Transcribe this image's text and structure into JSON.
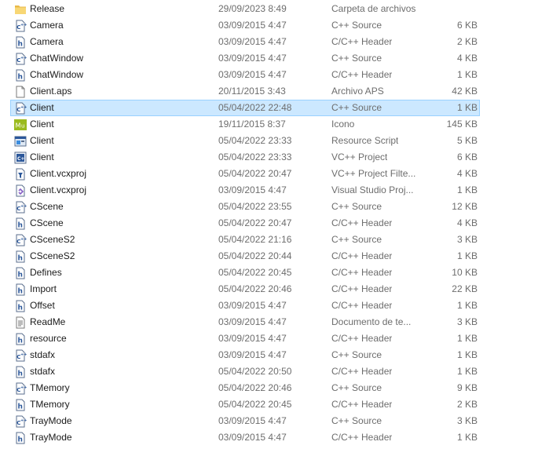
{
  "files": [
    {
      "name": "Release",
      "date": "29/09/2023 8:49",
      "type": "Carpeta de archivos",
      "size": "",
      "icon": "folder-icon"
    },
    {
      "name": "Camera",
      "date": "03/09/2015 4:47",
      "type": "C++ Source",
      "size": "6 KB",
      "icon": "cpp-source-icon"
    },
    {
      "name": "Camera",
      "date": "03/09/2015 4:47",
      "type": "C/C++ Header",
      "size": "2 KB",
      "icon": "c-header-icon"
    },
    {
      "name": "ChatWindow",
      "date": "03/09/2015 4:47",
      "type": "C++ Source",
      "size": "4 KB",
      "icon": "cpp-source-icon"
    },
    {
      "name": "ChatWindow",
      "date": "03/09/2015 4:47",
      "type": "C/C++ Header",
      "size": "1 KB",
      "icon": "c-header-icon"
    },
    {
      "name": "Client.aps",
      "date": "20/11/2015 3:43",
      "type": "Archivo APS",
      "size": "42 KB",
      "icon": "generic-file-icon"
    },
    {
      "name": "Client",
      "date": "05/04/2022 22:48",
      "type": "C++ Source",
      "size": "1 KB",
      "icon": "cpp-source-icon",
      "selected": true
    },
    {
      "name": "Client",
      "date": "19/11/2015 8:37",
      "type": "Icono",
      "size": "145 KB",
      "icon": "ico-file-icon"
    },
    {
      "name": "Client",
      "date": "05/04/2022 23:33",
      "type": "Resource Script",
      "size": "5 KB",
      "icon": "resource-script-icon"
    },
    {
      "name": "Client",
      "date": "05/04/2022 23:33",
      "type": "VC++ Project",
      "size": "6 KB",
      "icon": "vcpp-project-icon"
    },
    {
      "name": "Client.vcxproj",
      "date": "05/04/2022 20:47",
      "type": "VC++ Project Filte...",
      "size": "4 KB",
      "icon": "vcpp-filters-icon"
    },
    {
      "name": "Client.vcxproj",
      "date": "03/09/2015 4:47",
      "type": "Visual Studio Proj...",
      "size": "1 KB",
      "icon": "vs-project-icon"
    },
    {
      "name": "CScene",
      "date": "05/04/2022 23:55",
      "type": "C++ Source",
      "size": "12 KB",
      "icon": "cpp-source-icon"
    },
    {
      "name": "CScene",
      "date": "05/04/2022 20:47",
      "type": "C/C++ Header",
      "size": "4 KB",
      "icon": "c-header-icon"
    },
    {
      "name": "CSceneS2",
      "date": "05/04/2022 21:16",
      "type": "C++ Source",
      "size": "3 KB",
      "icon": "cpp-source-icon"
    },
    {
      "name": "CSceneS2",
      "date": "05/04/2022 20:44",
      "type": "C/C++ Header",
      "size": "1 KB",
      "icon": "c-header-icon"
    },
    {
      "name": "Defines",
      "date": "05/04/2022 20:45",
      "type": "C/C++ Header",
      "size": "10 KB",
      "icon": "c-header-icon"
    },
    {
      "name": "Import",
      "date": "05/04/2022 20:46",
      "type": "C/C++ Header",
      "size": "22 KB",
      "icon": "c-header-icon"
    },
    {
      "name": "Offset",
      "date": "03/09/2015 4:47",
      "type": "C/C++ Header",
      "size": "1 KB",
      "icon": "c-header-icon"
    },
    {
      "name": "ReadMe",
      "date": "03/09/2015 4:47",
      "type": "Documento de te...",
      "size": "3 KB",
      "icon": "text-document-icon"
    },
    {
      "name": "resource",
      "date": "03/09/2015 4:47",
      "type": "C/C++ Header",
      "size": "1 KB",
      "icon": "c-header-icon"
    },
    {
      "name": "stdafx",
      "date": "03/09/2015 4:47",
      "type": "C++ Source",
      "size": "1 KB",
      "icon": "cpp-source-icon"
    },
    {
      "name": "stdafx",
      "date": "05/04/2022 20:50",
      "type": "C/C++ Header",
      "size": "1 KB",
      "icon": "c-header-icon"
    },
    {
      "name": "TMemory",
      "date": "05/04/2022 20:46",
      "type": "C++ Source",
      "size": "9 KB",
      "icon": "cpp-source-icon"
    },
    {
      "name": "TMemory",
      "date": "05/04/2022 20:45",
      "type": "C/C++ Header",
      "size": "2 KB",
      "icon": "c-header-icon"
    },
    {
      "name": "TrayMode",
      "date": "03/09/2015 4:47",
      "type": "C++ Source",
      "size": "3 KB",
      "icon": "cpp-source-icon"
    },
    {
      "name": "TrayMode",
      "date": "03/09/2015 4:47",
      "type": "C/C++ Header",
      "size": "1 KB",
      "icon": "c-header-icon"
    }
  ],
  "colors": {
    "selection_fill": "#cce8ff",
    "selection_border": "#99d1ff",
    "folder": "#f8d775",
    "icon_blue": "#2b579a",
    "ico_green": "#9bbb1e"
  }
}
